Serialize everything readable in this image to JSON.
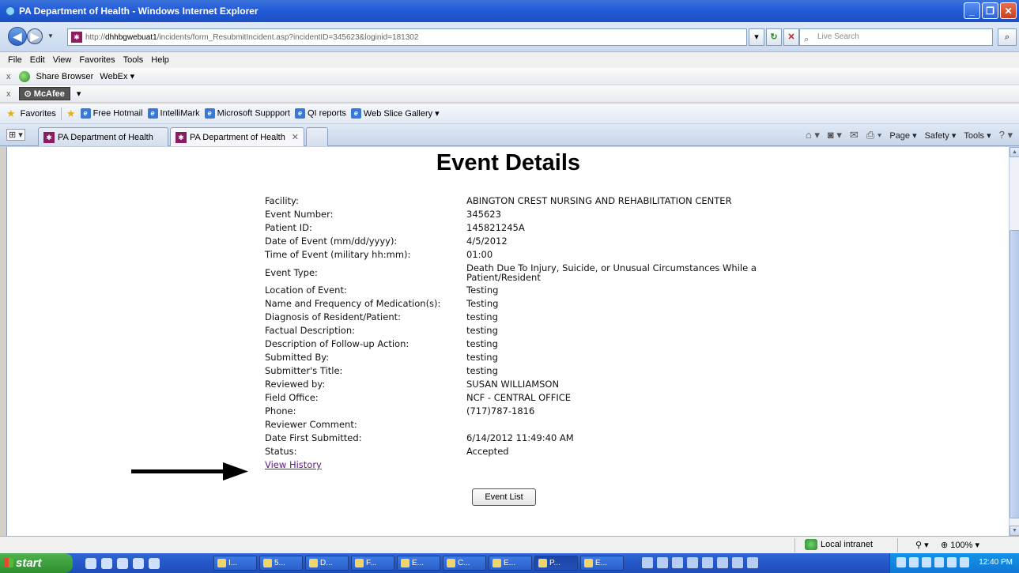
{
  "window": {
    "title": "PA Department of Health - Windows Internet Explorer"
  },
  "address": {
    "url_prefix": "http://",
    "url_host": "dhhbgwebuat1",
    "url_path": "/incidents/form_ResubmitIncident.asp?incidentID=345623&loginid=181302",
    "search_placeholder": "Live Search"
  },
  "menu": [
    "File",
    "Edit",
    "View",
    "Favorites",
    "Tools",
    "Help"
  ],
  "toolbar1": {
    "share_browser": "Share Browser",
    "webex": "WebEx"
  },
  "toolbar2": {
    "mcafee": "McAfee"
  },
  "favorites_bar": {
    "label": "Favorites",
    "items": [
      "Free Hotmail",
      "IntelliMark",
      "Microsoft Suppport",
      "QI reports",
      "Web Slice Gallery"
    ]
  },
  "tabs": [
    {
      "label": "PA Department of Health"
    },
    {
      "label": "PA Department of Health"
    }
  ],
  "command_bar": {
    "page": "Page",
    "safety": "Safety",
    "tools": "Tools"
  },
  "page": {
    "title": "Event Details",
    "fields": [
      {
        "label": "Facility:",
        "value": "ABINGTON CREST NURSING AND REHABILITATION CENTER"
      },
      {
        "label": "Event Number:",
        "value": "345623"
      },
      {
        "label": "Patient ID:",
        "value": "145821245A"
      },
      {
        "label": "Date of Event (mm/dd/yyyy):",
        "value": "4/5/2012"
      },
      {
        "label": "Time of Event (military hh:mm):",
        "value": "01:00"
      },
      {
        "label": "Event Type:",
        "value": "Death Due To Injury, Suicide, or Unusual Circumstances While a Patient/Resident"
      },
      {
        "label": "Location of Event:",
        "value": "Testing"
      },
      {
        "label": "Name and Frequency of Medication(s):",
        "value": "Testing"
      },
      {
        "label": "Diagnosis of Resident/Patient:",
        "value": "testing"
      },
      {
        "label": "Factual Description:",
        "value": "testing"
      },
      {
        "label": "Description of Follow-up Action:",
        "value": "testing"
      },
      {
        "label": "Submitted By:",
        "value": "testing"
      },
      {
        "label": "Submitter's Title:",
        "value": "testing"
      },
      {
        "label": "Reviewed by:",
        "value": "SUSAN WILLIAMSON"
      },
      {
        "label": "Field Office:",
        "value": "NCF - CENTRAL OFFICE"
      },
      {
        "label": "Phone:",
        "value": "(717)787-1816"
      },
      {
        "label": "Reviewer Comment:",
        "value": ""
      },
      {
        "label": "Date First Submitted:",
        "value": "6/14/2012 11:49:40 AM"
      },
      {
        "label": "Status:",
        "value": "Accepted"
      }
    ],
    "view_history": "View History",
    "event_list_button": "Event List"
  },
  "statusbar": {
    "zone": "Local intranet",
    "zoom": "100%"
  },
  "taskbar": {
    "start": "start",
    "buttons": [
      "I...",
      "5...",
      "D...",
      "F...",
      "E...",
      "C...",
      "E...",
      "P...",
      "E..."
    ],
    "clock": "12:40 PM"
  }
}
